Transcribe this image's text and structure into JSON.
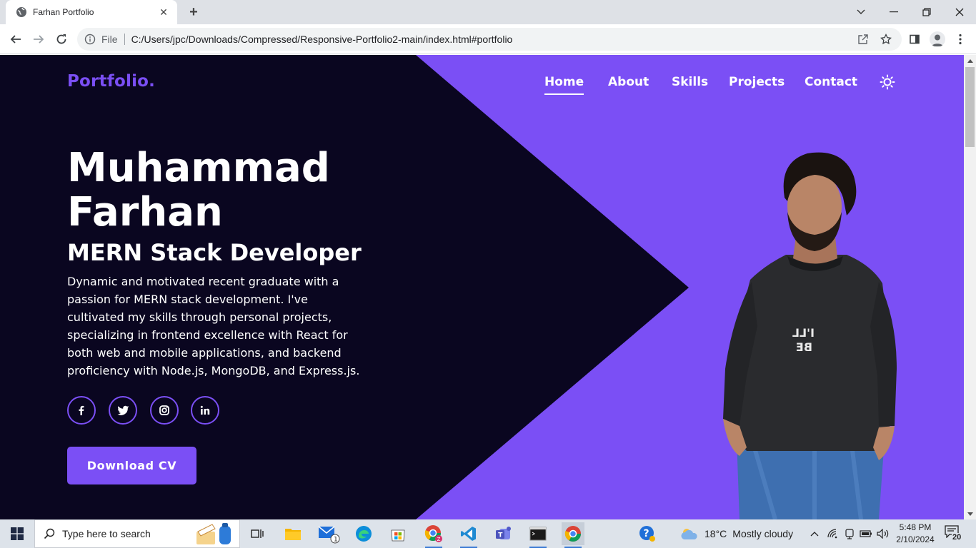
{
  "browser": {
    "tab_title": "Farhan Portfolio",
    "omnibox_scheme": "File",
    "url": "C:/Users/jpc/Downloads/Compressed/Responsive-Portfolio2-main/index.html#portfolio"
  },
  "site": {
    "logo": "Portfolio.",
    "nav": [
      "Home",
      "About",
      "Skills",
      "Projects",
      "Contact"
    ],
    "active_nav": "Home",
    "name_line1": "Muhammad",
    "name_line2": "Farhan",
    "role": "MERN Stack Developer",
    "bio": "Dynamic and motivated recent graduate with a passion for MERN stack development. I've cultivated my skills through personal projects, specializing in frontend excellence with React for both web and mobile applications, and backend proficiency with Node.js, MongoDB, and Express.js.",
    "socials": [
      "facebook-icon",
      "twitter-icon",
      "instagram-icon",
      "linkedin-icon"
    ],
    "cta": "Download CV",
    "colors": {
      "accent": "#7b4ff5",
      "dark_bg": "#0a0620"
    }
  },
  "taskbar": {
    "search_placeholder": "Type here to search",
    "temperature": "18°C",
    "condition": "Mostly cloudy",
    "time": "5:48 PM",
    "date": "2/10/2024",
    "notification_count": "20",
    "mail_badge": "1"
  }
}
